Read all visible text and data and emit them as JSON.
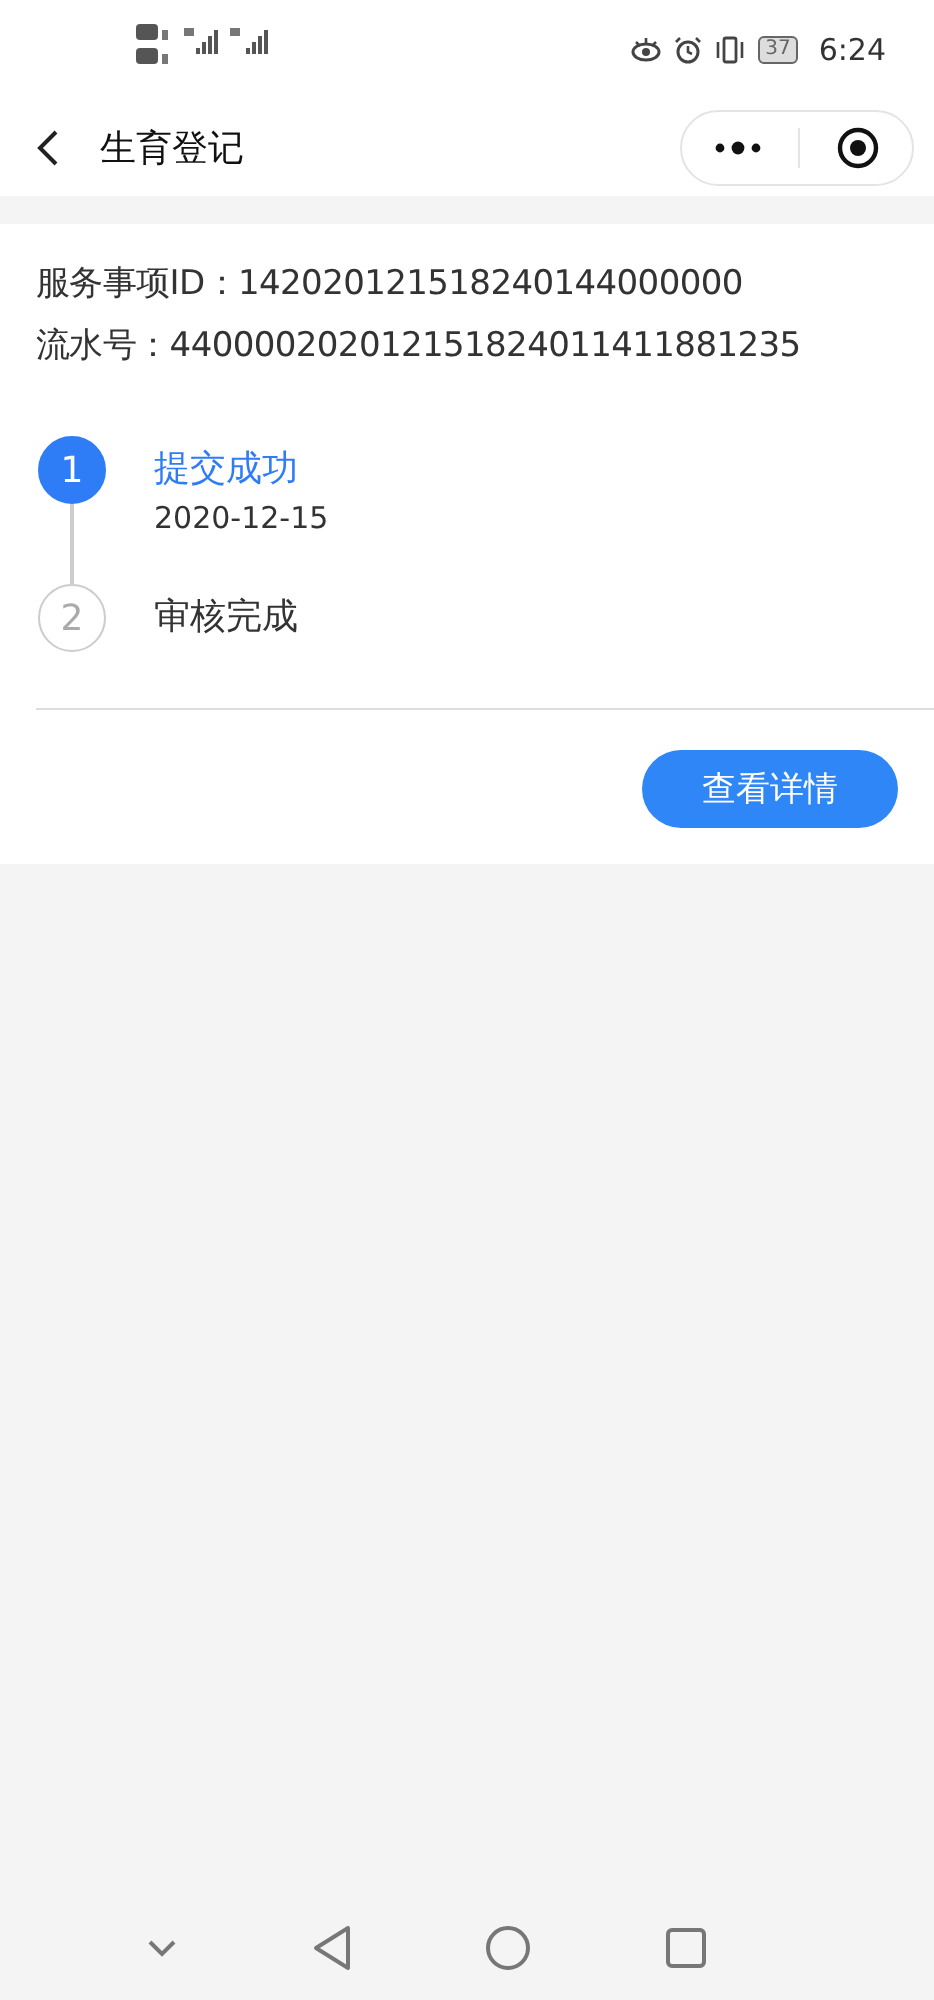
{
  "status_bar": {
    "battery": "37",
    "time": "6:24"
  },
  "header": {
    "title": "生育登记"
  },
  "info": [
    {
      "label": "服务事项ID：",
      "value": "142020121518240144000000"
    },
    {
      "label": "流水号：",
      "value": "440000202012151824011411881235"
    }
  ],
  "steps": [
    {
      "number": "1",
      "title": "提交成功",
      "date": "2020-12-15",
      "active": true
    },
    {
      "number": "2",
      "title": "审核完成",
      "active": false
    }
  ],
  "details_button": "查看详情"
}
